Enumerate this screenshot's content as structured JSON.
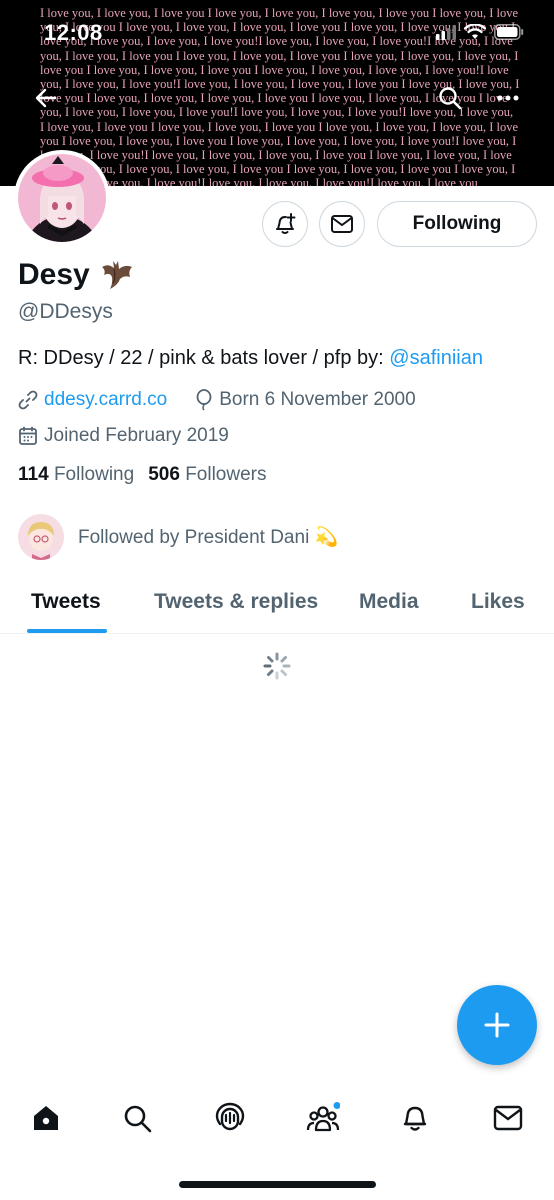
{
  "status_bar": {
    "time": "12:08"
  },
  "banner": {
    "phrase": "I love you, I love you, I love you I love you, I love you, I love you, I love you I love you, I love you, I love you I love you, I love you, I love you, I love you I love you, I love you, I love you I love you, I love you, I love you, I love you!I love you, I love you, I love you!I love you, I love you, I love you, I love you I love you, I love you, I love you I love you, I love you, I love you, I love you I love you, I love you, I love you I love you, I love you, I love you, I love you!I love you, I love you, I love you!I love you, I love you, I love you, I love you I love you, I love you, I love you I love you, I love you, I love you, I love you I love you, I love you, I love you I love you, I love you, I love you, I love you!I love you, I love you, I love you!I love you, I love you, I love you, I love you I love you, I love you, I love you I love you, I love you, I love you, I love you I love you, I love you, I love you I love you, I love you, I love you, I love you!I love you, I love you, I love you!I love you, I love you, I love you, I love you I love you, I love you, I love you I love you, I love you, I love you, I love you I love you, I love you, I love you I love you, I love you, I love you, I love you!I love you, I love you, I love you!I love you, I love you"
  },
  "profile": {
    "name": "Desy",
    "name_emoji": "bat-emoji",
    "handle": "@DDesys",
    "bio_text": "R: DDesy / 22 / pink & bats lover / pfp by: ",
    "bio_mention": "@safiniian",
    "website": "ddesy.carrd.co",
    "birthday": "Born 6 November 2000",
    "joined": "Joined February 2019",
    "following_count": "114",
    "following_label": "Following",
    "followers_count": "506",
    "followers_label": "Followers",
    "followed_by": "Followed by President Dani 💫"
  },
  "actions": {
    "follow_label": "Following"
  },
  "tabs": [
    {
      "label": "Tweets"
    },
    {
      "label": "Tweets & replies"
    },
    {
      "label": "Media"
    },
    {
      "label": "Likes"
    }
  ],
  "colors": {
    "accent": "#1d9bf0",
    "text": "#0f1419",
    "muted": "#536471",
    "banner_text": "#e7a3b6"
  }
}
